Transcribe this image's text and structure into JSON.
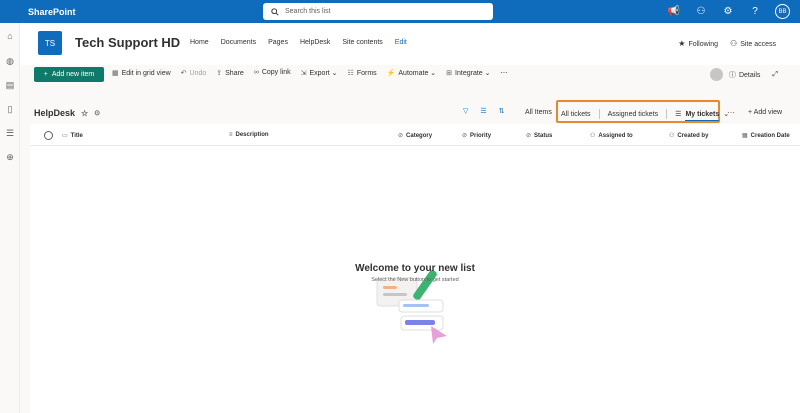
{
  "suite": {
    "brand": "SharePoint",
    "search_placeholder": "Search this list",
    "avatar_initials": "BB"
  },
  "site": {
    "logo": "TS",
    "title": "Tech Support HD",
    "nav": [
      "Home",
      "Documents",
      "Pages",
      "HelpDesk",
      "Site contents",
      "Edit"
    ],
    "following": "Following",
    "site_access": "Site access"
  },
  "commands": {
    "new_item": "Add new item",
    "items": [
      "Edit in grid view",
      "Undo",
      "Share",
      "Copy link",
      "Export",
      "Forms",
      "Automate",
      "Integrate"
    ],
    "details": "Details"
  },
  "list": {
    "name": "HelpDesk",
    "all_items": "All Items",
    "views": [
      "All tickets",
      "Assigned tickets",
      "My tickets"
    ],
    "add_view": "Add view",
    "columns": [
      "Title",
      "Description",
      "Category",
      "Priority",
      "Status",
      "Assigned to",
      "Created by",
      "Creation Date"
    ]
  },
  "empty_state": {
    "heading": "Welcome to your new list",
    "subtext": "Select the New button to get started"
  },
  "colors": {
    "suite_bar": "#0f6cbd",
    "accent": "#0f6cbd",
    "new_button": "#0e7a6a",
    "highlight_box": "#e8892b"
  }
}
